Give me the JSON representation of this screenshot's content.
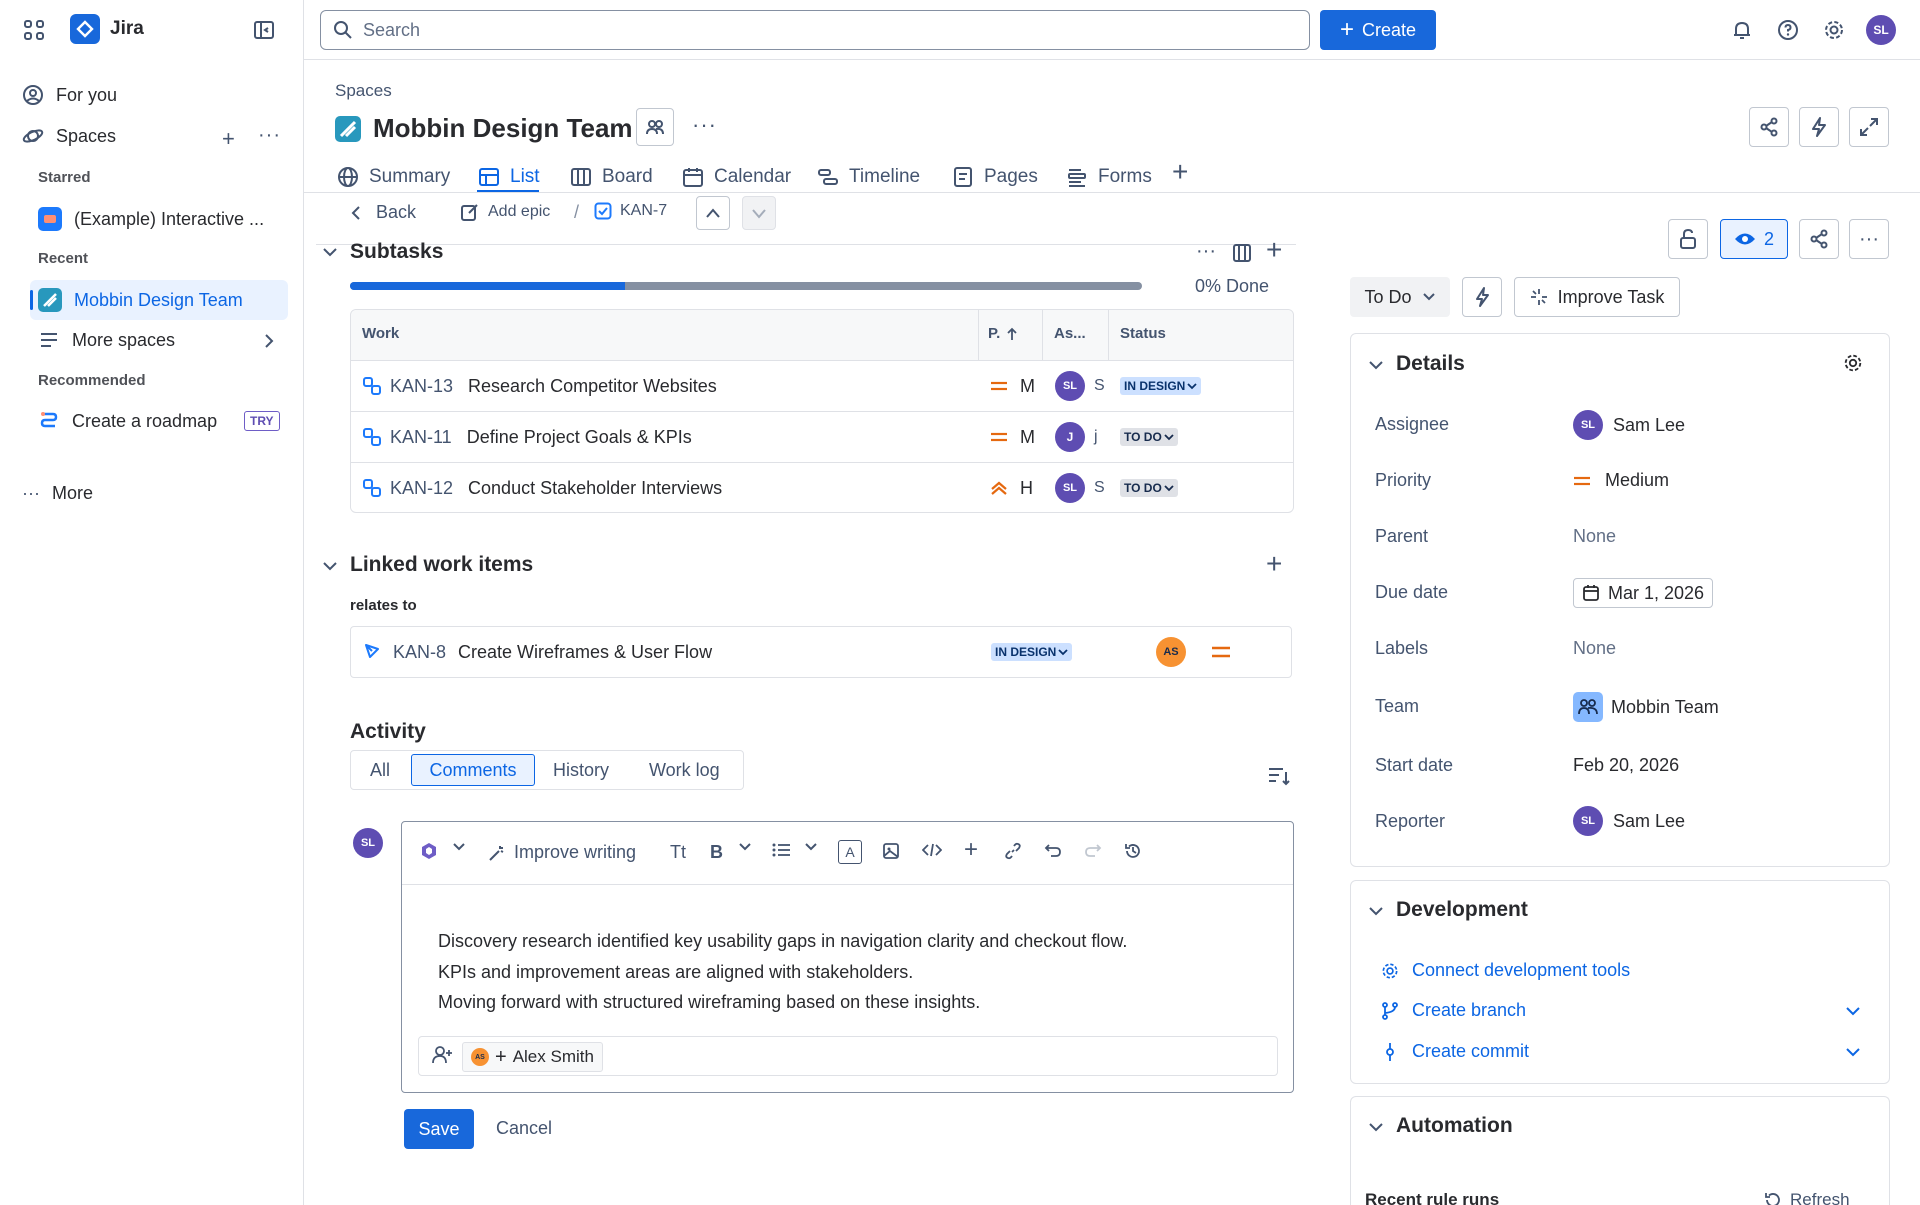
{
  "app": {
    "name": "Jira"
  },
  "search": {
    "placeholder": "Search"
  },
  "topbar": {
    "create_label": "Create",
    "user_initials": "SL"
  },
  "sidebar": {
    "for_you": "For you",
    "spaces": "Spaces",
    "starred_header": "Starred",
    "starred_item": "(Example) Interactive ...",
    "recent_header": "Recent",
    "recent_item": "Mobbin Design Team",
    "more_spaces": "More spaces",
    "recommended_header": "Recommended",
    "roadmap": "Create a roadmap",
    "try_badge": "TRY",
    "more": "More"
  },
  "project": {
    "breadcrumb": "Spaces",
    "title": "Mobbin Design Team",
    "tabs": [
      "Summary",
      "List",
      "Board",
      "Calendar",
      "Timeline",
      "Pages",
      "Forms"
    ],
    "active_tab": "List"
  },
  "issue_nav": {
    "back": "Back",
    "add_epic": "Add epic",
    "separator": "/",
    "key": "KAN-7"
  },
  "subtasks": {
    "title": "Subtasks",
    "progress_label": "0% Done",
    "progress_fraction": 0.0,
    "columns": {
      "work": "Work",
      "priority": "P.",
      "assignee": "As...",
      "status": "Status"
    },
    "rows": [
      {
        "key": "KAN-13",
        "summary": "Research Competitor Websites",
        "priority": "M",
        "assignee": "SL",
        "assignee_trunc": "S",
        "status": "IN DESIGN"
      },
      {
        "key": "KAN-11",
        "summary": "Define Project Goals & KPIs",
        "priority": "M",
        "assignee": "J",
        "assignee_trunc": "j",
        "status": "TO DO"
      },
      {
        "key": "KAN-12",
        "summary": "Conduct Stakeholder Interviews",
        "priority": "H",
        "assignee": "SL",
        "assignee_trunc": "S",
        "status": "TO DO"
      }
    ]
  },
  "linked": {
    "title": "Linked work items",
    "relation": "relates to",
    "item": {
      "key": "KAN-8",
      "summary": "Create Wireframes & User Flow",
      "status": "IN DESIGN",
      "assignee": "AS"
    }
  },
  "activity": {
    "title": "Activity",
    "tabs": [
      "All",
      "Comments",
      "History",
      "Work log"
    ],
    "active_tab": "Comments",
    "editor": {
      "commenter": "SL",
      "improve_writing": "Improve writing",
      "lines": [
        "Discovery research identified key usability gaps in navigation clarity and checkout flow.",
        "KPIs and improvement areas are aligned with stakeholders.",
        "Moving forward with structured wireframing based on these insights."
      ],
      "mention": "Alex Smith",
      "mention_initials": "AS"
    },
    "save": "Save",
    "cancel": "Cancel"
  },
  "right": {
    "watchers": "2",
    "status": "To Do",
    "improve_task": "Improve Task",
    "details_title": "Details",
    "fields": [
      {
        "label": "Assignee",
        "value": "Sam Lee",
        "initials": "SL"
      },
      {
        "label": "Priority",
        "value": "Medium"
      },
      {
        "label": "Parent",
        "value": "None"
      },
      {
        "label": "Due date",
        "value": "Mar 1, 2026"
      },
      {
        "label": "Labels",
        "value": "None"
      },
      {
        "label": "Team",
        "value": "Mobbin Team"
      },
      {
        "label": "Start date",
        "value": "Feb 20, 2026"
      },
      {
        "label": "Reporter",
        "value": "Sam Lee",
        "initials": "SL"
      }
    ],
    "development_title": "Development",
    "dev_links": [
      "Connect development tools",
      "Create branch",
      "Create commit"
    ],
    "automation_title": "Automation",
    "recent_rule_runs": "Recent rule runs",
    "refresh": "Refresh"
  },
  "colors": {
    "accent": "#0c66e4",
    "priority_medium": "#e56910",
    "avatar_sl": "#5e4db2",
    "avatar_as": "#f79232"
  }
}
